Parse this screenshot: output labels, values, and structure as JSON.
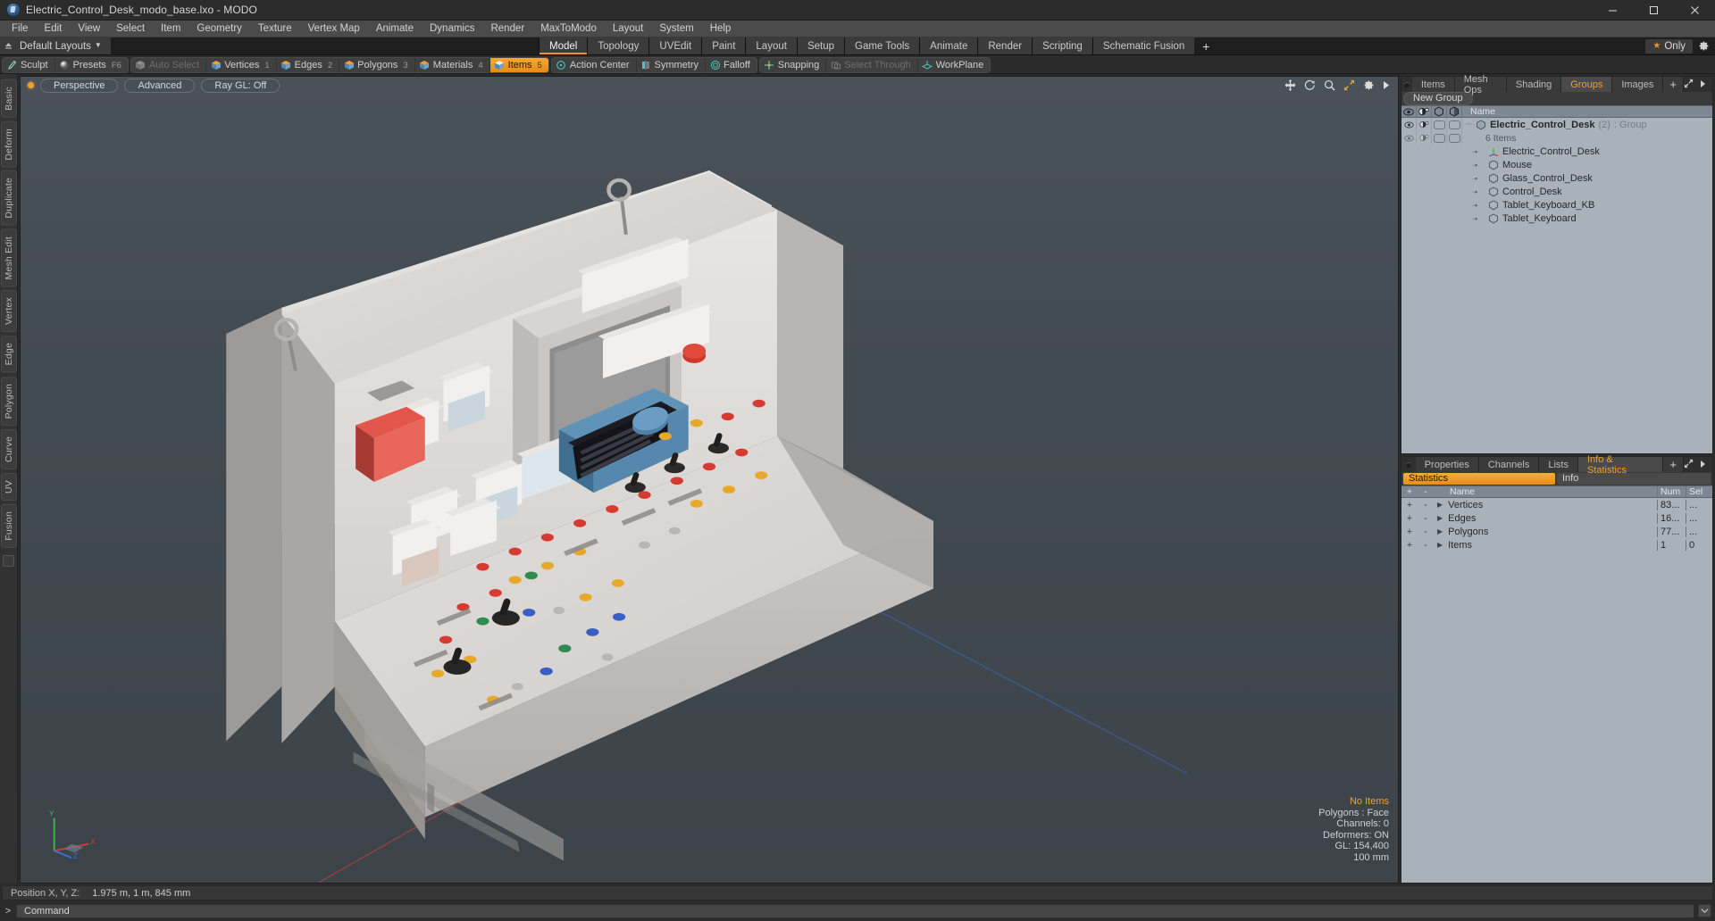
{
  "titlebar": {
    "title": "Electric_Control_Desk_modo_base.lxo - MODO",
    "logo_icon": "modo-logo-icon",
    "minimize_icon": "minimize-icon",
    "maximize_icon": "maximize-icon",
    "close_icon": "close-icon"
  },
  "menubar": {
    "items": [
      {
        "label": "File"
      },
      {
        "label": "Edit"
      },
      {
        "label": "View"
      },
      {
        "label": "Select"
      },
      {
        "label": "Item"
      },
      {
        "label": "Geometry"
      },
      {
        "label": "Texture"
      },
      {
        "label": "Vertex Map"
      },
      {
        "label": "Animate"
      },
      {
        "label": "Dynamics"
      },
      {
        "label": "Render"
      },
      {
        "label": "MaxToModo"
      },
      {
        "label": "Layout"
      },
      {
        "label": "System"
      },
      {
        "label": "Help"
      }
    ]
  },
  "layoutbar": {
    "default_layouts": "Default Layouts",
    "caret_icon": "chevron-down-icon",
    "pin_icon": "pin-up-icon",
    "tabs": [
      {
        "label": "Model",
        "active": true
      },
      {
        "label": "Topology",
        "active": false
      },
      {
        "label": "UVEdit",
        "active": false
      },
      {
        "label": "Paint",
        "active": false
      },
      {
        "label": "Layout",
        "active": false
      },
      {
        "label": "Setup",
        "active": false
      },
      {
        "label": "Game Tools",
        "active": false
      },
      {
        "label": "Animate",
        "active": false
      },
      {
        "label": "Render",
        "active": false
      },
      {
        "label": "Scripting",
        "active": false
      },
      {
        "label": "Schematic Fusion",
        "active": false
      }
    ],
    "add_tab_label": "+",
    "only_label": "Only",
    "star_icon": "star-icon",
    "gear_icon": "gear-icon"
  },
  "modebar": {
    "groups": [
      {
        "buttons": [
          {
            "label": "Sculpt",
            "icon": "brush-icon",
            "state": "normal"
          },
          {
            "label": "Presets",
            "icon": "sphere-icon",
            "state": "normal",
            "suffix": "F6"
          }
        ]
      },
      {
        "buttons": [
          {
            "label": "Auto Select",
            "icon": "cube-grey-icon",
            "state": "dim"
          },
          {
            "label": "Vertices",
            "icon": "cube-vertices-icon",
            "state": "normal",
            "num": "1"
          },
          {
            "label": "Edges",
            "icon": "cube-edges-icon",
            "state": "normal",
            "num": "2"
          },
          {
            "label": "Polygons",
            "icon": "cube-polygons-icon",
            "state": "normal",
            "num": "3"
          },
          {
            "label": "Materials",
            "icon": "cube-materials-icon",
            "state": "normal",
            "num": "4"
          },
          {
            "label": "Items",
            "icon": "cube-items-icon",
            "state": "active",
            "num": "5"
          }
        ]
      },
      {
        "buttons": [
          {
            "label": "Action Center",
            "icon": "action-center-icon",
            "state": "normal"
          },
          {
            "label": "Symmetry",
            "icon": "symmetry-icon",
            "state": "normal"
          },
          {
            "label": "Falloff",
            "icon": "falloff-icon",
            "state": "normal"
          }
        ]
      },
      {
        "buttons": [
          {
            "label": "Snapping",
            "icon": "snapping-icon",
            "state": "normal"
          },
          {
            "label": "Select Through",
            "icon": "select-through-icon",
            "state": "dim"
          },
          {
            "label": "WorkPlane",
            "icon": "workplane-icon",
            "state": "normal"
          }
        ]
      }
    ]
  },
  "leftrail": {
    "tabs": [
      "Basic",
      "Deform",
      "Duplicate",
      "Mesh Edit",
      "Vertex",
      "Edge",
      "Polygon",
      "Curve",
      "UV",
      "Fusion"
    ]
  },
  "viewport": {
    "indicator_icon": "viewport-active-dot",
    "pills": [
      {
        "label": "Perspective"
      },
      {
        "label": "Advanced"
      },
      {
        "label": "Ray GL: Off"
      }
    ],
    "tool_icons": [
      "move-icon",
      "rotate-icon",
      "zoom-icon",
      "fit-icon",
      "gear-icon",
      "chevron-right-icon"
    ],
    "stats": {
      "selection": "No Items",
      "polygons": "Polygons : Face",
      "channels": "Channels: 0",
      "deformers": "Deformers: ON",
      "gl": "GL: 154,400",
      "grid": "100 mm"
    },
    "axis_labels": {
      "x": "X",
      "y": "Y",
      "z": "Z"
    }
  },
  "groups_panel": {
    "tabs": [
      {
        "label": "Items",
        "active": false
      },
      {
        "label": "Mesh Ops",
        "active": false
      },
      {
        "label": "Shading",
        "active": false
      },
      {
        "label": "Groups",
        "active": true
      },
      {
        "label": "Images",
        "active": false
      },
      {
        "label": "+",
        "active": false
      }
    ],
    "expand_icon": "expand-icon",
    "more_icon": "chevron-right-icon",
    "new_group_button": "New Group",
    "columns": {
      "eye_icon": "eye-icon",
      "render_icon": "render-camera-icon",
      "lock_icon": "shape-outline-icon",
      "cube_icon": "shape-solid-icon",
      "name": "Name"
    },
    "rows": [
      {
        "name": "Electric_Control_Desk",
        "count": "(2)",
        "type": ": Group",
        "level": 0,
        "icon": "group-icon",
        "bold": true,
        "has_cells": true
      },
      {
        "name": "6 Items",
        "level": 1,
        "icon": "none",
        "sub": true
      },
      {
        "name": "Electric_Control_Desk",
        "level": 2,
        "icon": "locator-icon"
      },
      {
        "name": "Mouse",
        "level": 2,
        "icon": "mesh-icon"
      },
      {
        "name": "Glass_Control_Desk",
        "level": 2,
        "icon": "mesh-icon"
      },
      {
        "name": "Control_Desk",
        "level": 2,
        "icon": "mesh-icon"
      },
      {
        "name": "Tablet_Keyboard_KB",
        "level": 2,
        "icon": "mesh-icon"
      },
      {
        "name": "Tablet_Keyboard",
        "level": 2,
        "icon": "mesh-icon"
      }
    ]
  },
  "info_panel": {
    "tabs": [
      {
        "label": "Properties",
        "active": false
      },
      {
        "label": "Channels",
        "active": false
      },
      {
        "label": "Lists",
        "active": false
      },
      {
        "label": "Info & Statistics",
        "active": true
      },
      {
        "label": "+",
        "active": false
      }
    ],
    "expand_icon": "expand-icon",
    "more_icon": "chevron-right-icon",
    "segments": [
      {
        "label": "Statistics",
        "active": true
      },
      {
        "label": "Info",
        "active": false
      }
    ],
    "columns": {
      "plus": "+",
      "minus": "-",
      "name": "Name",
      "num": "Num",
      "sel": "Sel"
    },
    "rows": [
      {
        "name": "Vertices",
        "num": "83...",
        "sel": "...",
        "expandable": true
      },
      {
        "name": "Edges",
        "num": "16...",
        "sel": "...",
        "expandable": true
      },
      {
        "name": "Polygons",
        "num": "77...",
        "sel": "...",
        "expandable": true
      },
      {
        "name": "Items",
        "num": "1",
        "sel": "0",
        "expandable": true
      }
    ]
  },
  "statusbar": {
    "position_label": "Position X, Y, Z:",
    "position_value": "1.975 m,  1 m,  845 mm"
  },
  "commandbar": {
    "prompt": ">",
    "placeholder": "Command",
    "value": "",
    "history_icon": "history-icon"
  }
}
